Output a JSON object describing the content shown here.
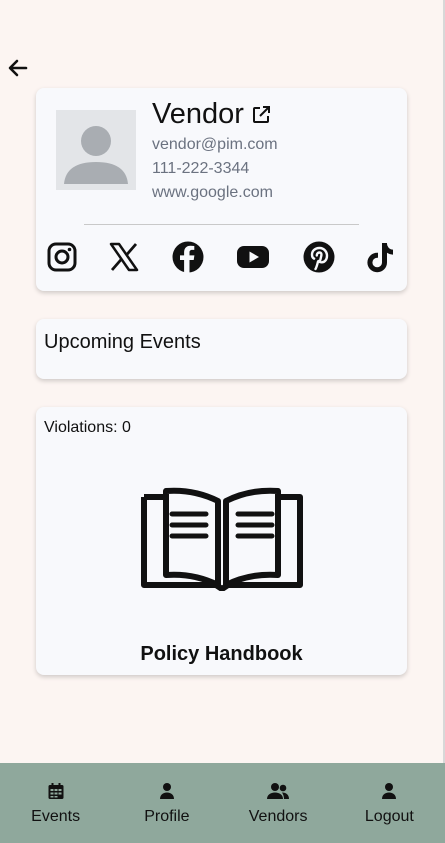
{
  "vendor": {
    "name": "Vendor",
    "email": "vendor@pim.com",
    "phone": "111-222-3344",
    "website": "www.google.com"
  },
  "social_links": [
    {
      "icon": "instagram-icon"
    },
    {
      "icon": "x-twitter-icon"
    },
    {
      "icon": "facebook-icon"
    },
    {
      "icon": "youtube-icon"
    },
    {
      "icon": "pinterest-icon"
    },
    {
      "icon": "tiktok-icon"
    }
  ],
  "events": {
    "title": "Upcoming Events"
  },
  "policy": {
    "violations": "Violations: 0",
    "handbook_label": "Policy Handbook"
  },
  "nav": {
    "items": [
      {
        "label": "Events",
        "icon": "calendar-icon"
      },
      {
        "label": "Profile",
        "icon": "user-icon"
      },
      {
        "label": "Vendors",
        "icon": "users-icon"
      },
      {
        "label": "Logout",
        "icon": "user-icon"
      }
    ]
  },
  "colors": {
    "background": "#fcf5f2",
    "card": "#f8f9fc",
    "navbar": "#8fa89c",
    "muted_text": "#6b7280"
  }
}
